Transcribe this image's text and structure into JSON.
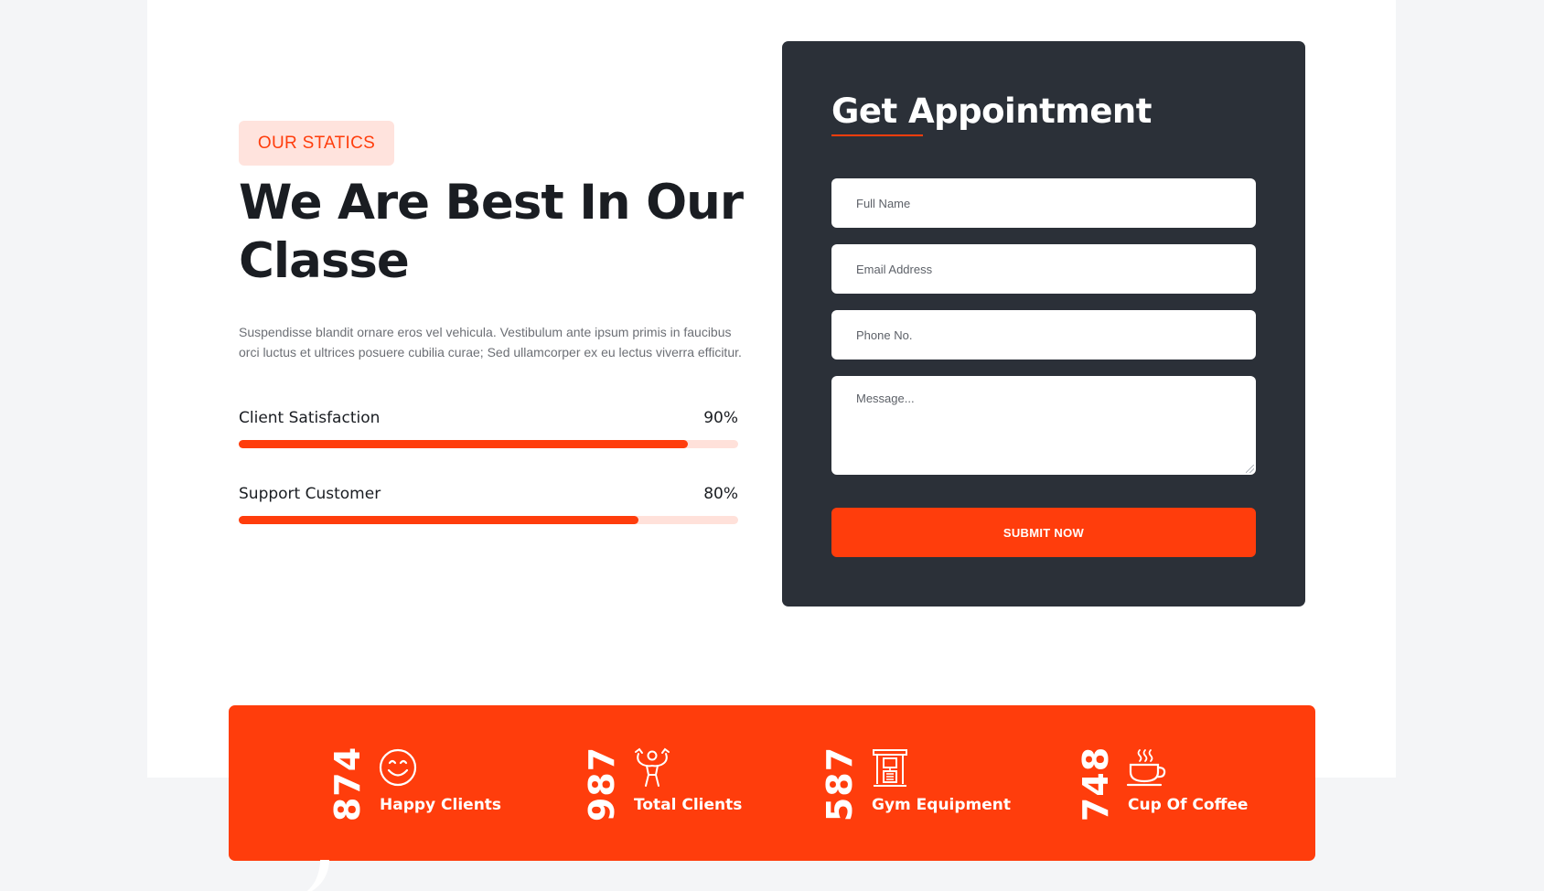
{
  "about": {
    "tag": "OUR STATICS",
    "headline_line1": "We Are Best In Our",
    "headline_line2": "Classe",
    "description": "Suspendisse blandit ornare eros vel vehicula. Vestibulum ante ipsum primis in faucibus orci luctus et ultrices posuere cubilia curae; Sed ullamcorper ex eu lectus viverra efficitur.",
    "skills": [
      {
        "label": "Client Satisfaction",
        "percent_text": "90%",
        "value": 90
      },
      {
        "label": "Support Customer",
        "percent_text": "80%",
        "value": 80
      }
    ]
  },
  "appointment": {
    "title": "Get Appointment",
    "fields": [
      {
        "placeholder": "Full Name"
      },
      {
        "placeholder": "Email Address"
      },
      {
        "placeholder": "Phone No."
      },
      {
        "placeholder": "Message..."
      }
    ],
    "submit_label": "SUBMIT NOW"
  },
  "stats": [
    {
      "number": "874",
      "label": "Happy Clients",
      "icon": "smiley-icon"
    },
    {
      "number": "987",
      "label": "Total Clients",
      "icon": "bodybuilder-icon"
    },
    {
      "number": "587",
      "label": "Gym Equipment",
      "icon": "gym-machine-icon"
    },
    {
      "number": "748",
      "label": "Cup Of Coffee",
      "icon": "coffee-cup-icon"
    }
  ],
  "colors": {
    "accent": "#ff3d0c",
    "accent_light": "#ffe3dd",
    "dark_card": "#2b3038",
    "heading": "#1a1d22",
    "page_bg": "#f4f5f7"
  }
}
